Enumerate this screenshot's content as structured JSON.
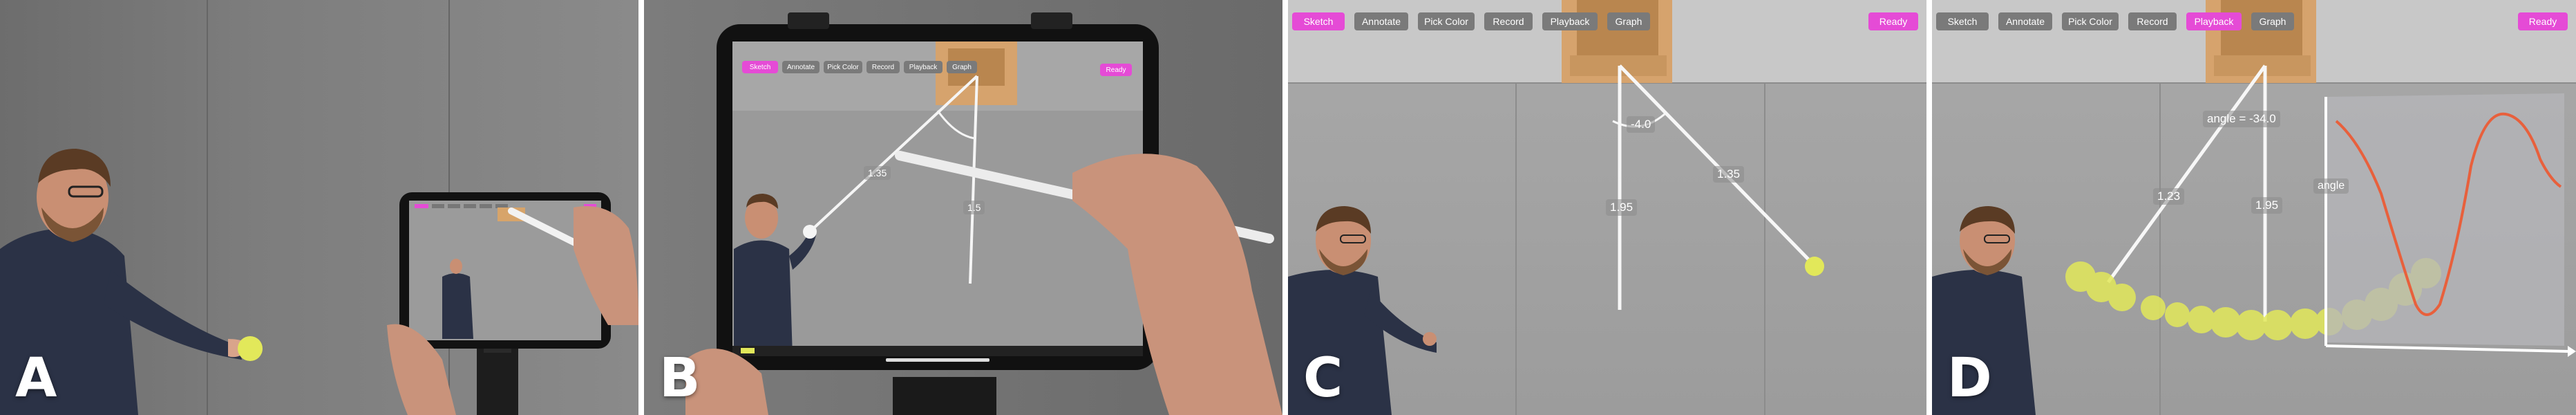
{
  "panels": {
    "a": {
      "letter": "A"
    },
    "b": {
      "letter": "B",
      "toolbar": [
        "Sketch",
        "Annotate",
        "Pick Color",
        "Record",
        "Playback",
        "Graph"
      ],
      "active": "Sketch",
      "ready": "Ready",
      "measures": [
        "1.35",
        "1.5"
      ]
    },
    "c": {
      "letter": "C",
      "toolbar": [
        "Sketch",
        "Annotate",
        "Pick Color",
        "Record",
        "Playback",
        "Graph"
      ],
      "active": "Sketch",
      "ready": "Ready",
      "angle_label": "-4.0",
      "measures": [
        "1.95",
        "1.35"
      ]
    },
    "d": {
      "letter": "D",
      "toolbar": [
        "Sketch",
        "Annotate",
        "Pick Color",
        "Record",
        "Playback",
        "Graph"
      ],
      "active": "Playback",
      "ready": "Ready",
      "angle_label": "angle = -34.0",
      "measures": [
        "1.23",
        "1.95"
      ],
      "graph_label": "angle"
    }
  },
  "colors": {
    "wall": "#8f8f8f",
    "accent": "#e54bd6",
    "ball": "#e2e85a",
    "graph_line": "#e8603c"
  }
}
